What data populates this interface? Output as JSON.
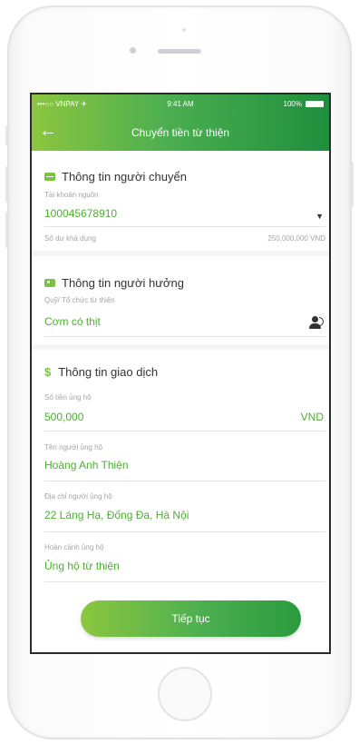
{
  "status_bar": {
    "carrier": "•••○○ VNPAY ✈",
    "time": "9:41 AM",
    "battery": "100%"
  },
  "header": {
    "back_icon": "←",
    "title": "Chuyển tiền từ thiện"
  },
  "sender": {
    "heading": "Thông tin người chuyển",
    "account_label": "Tài khoản nguồn",
    "account_value": "100045678910",
    "dropdown_icon": "▼",
    "balance_label": "Số dư khả dụng",
    "balance_value": "250,000,000 VND"
  },
  "beneficiary": {
    "heading": "Thông tin người hưởng",
    "fund_label": "Quỹ/ Tổ chức từ thiện",
    "fund_value": "Cơm có thịt"
  },
  "transaction": {
    "heading": "Thông tin giao dịch",
    "dollar_icon": "$",
    "amount_label": "Số tiền ủng hộ",
    "amount_value": "500,000",
    "currency": "VND",
    "donor_label": "Tên người ủng hộ",
    "donor_value": "Hoàng Anh Thiện",
    "address_label": "Địa chỉ người ủng hộ",
    "address_value": "22 Láng Hạ, Đống Đa, Hà Nội",
    "reason_label": "Hoàn cảnh ủng hộ",
    "reason_value": "Ủng hộ từ thiện"
  },
  "actions": {
    "continue_label": "Tiếp tục"
  },
  "colors": {
    "accent": "#4daf31",
    "header_dark": "#1f8e3d",
    "header_light": "#8cc63f"
  }
}
